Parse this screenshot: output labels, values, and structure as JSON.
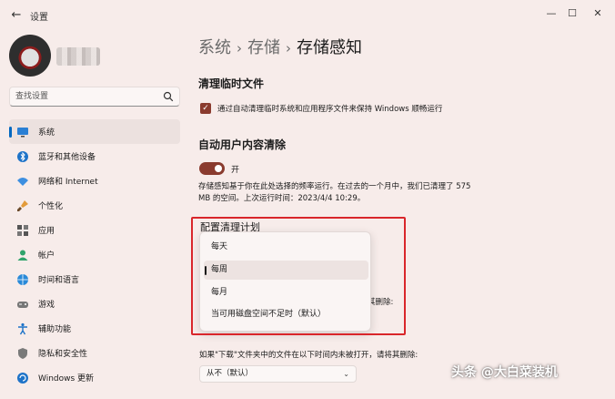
{
  "window": {
    "title": "设置",
    "back_icon": "←",
    "minimize_icon": "—",
    "maximize_icon": "☐",
    "close_icon": "✕"
  },
  "search": {
    "placeholder": "查找设置"
  },
  "sidebar": {
    "items": [
      {
        "label": "系统",
        "icon": "monitor-icon",
        "active": true
      },
      {
        "label": "蓝牙和其他设备",
        "icon": "bluetooth-icon"
      },
      {
        "label": "网络和 Internet",
        "icon": "wifi-icon"
      },
      {
        "label": "个性化",
        "icon": "brush-icon"
      },
      {
        "label": "应用",
        "icon": "apps-icon"
      },
      {
        "label": "帐户",
        "icon": "person-icon"
      },
      {
        "label": "时间和语言",
        "icon": "globe-icon"
      },
      {
        "label": "游戏",
        "icon": "gamepad-icon"
      },
      {
        "label": "辅助功能",
        "icon": "accessibility-icon"
      },
      {
        "label": "隐私和安全性",
        "icon": "shield-icon"
      },
      {
        "label": "Windows 更新",
        "icon": "update-icon"
      }
    ]
  },
  "breadcrumb": {
    "part1": "系统",
    "part2": "存储",
    "current": "存储感知",
    "separator": "›"
  },
  "temp_files": {
    "heading": "清理临时文件",
    "checkbox_label": "通过自动清理临时系统和应用程序文件来保持 Windows 顺畅运行",
    "checked": true
  },
  "auto_cleanup": {
    "heading": "自动用户内容清除",
    "toggle_label": "开",
    "toggle_on": true,
    "description": "存储感知基于你在此处选择的频率运行。在过去的一个月中，我们已清理了 575 MB 的空间。上次运行时间：2023/4/4 10:29。"
  },
  "schedule": {
    "label": "配置清理计划",
    "options": [
      "每天",
      "每周",
      "每月",
      "当可用磁盘空间不足时（默认）"
    ],
    "selected_index": 1,
    "partial_text_behind": "其删除:"
  },
  "downloads": {
    "label": "如果\"下载\"文件夹中的文件在以下时间内未被打开，请将其删除:",
    "value": "从不（默认）"
  },
  "watermark": "头条 @大白菜装机",
  "colors": {
    "accent": "#8a3b2e",
    "highlight_box": "#d9262b",
    "nav_active_bar": "#0067c0"
  }
}
